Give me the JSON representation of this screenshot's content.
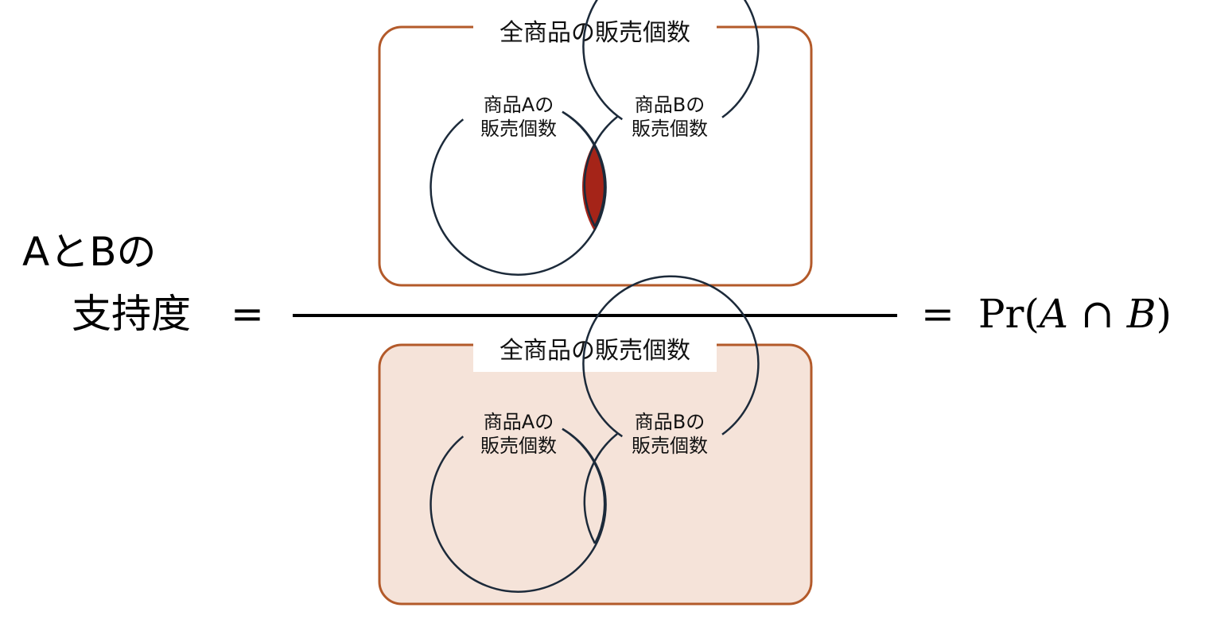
{
  "lhs": {
    "line1": "AとBの",
    "line2": "支持度",
    "equals": "="
  },
  "rhs": {
    "equals": "=",
    "pr": "Pr(",
    "var_a": "A",
    "cap": "∩",
    "var_b": "B",
    "close": ")"
  },
  "numerator": {
    "box_title": "全商品の販売個数",
    "circle_a_line1": "商品Aの",
    "circle_a_line2": "販売個数",
    "circle_b_line1": "商品Bの",
    "circle_b_line2": "販売個数",
    "highlight": "intersection"
  },
  "denominator": {
    "box_title": "全商品の販売個数",
    "circle_a_line1": "商品Aの",
    "circle_a_line2": "販売個数",
    "circle_b_line1": "商品Bの",
    "circle_b_line2": "販売個数",
    "highlight": "whole-box"
  },
  "colors": {
    "box_border": "#b35a2a",
    "box_fill_denominator": "#f5e3d9",
    "intersection_fill": "#a52418",
    "circle_stroke": "#1c2a3a",
    "fraction_line": "#000000"
  }
}
